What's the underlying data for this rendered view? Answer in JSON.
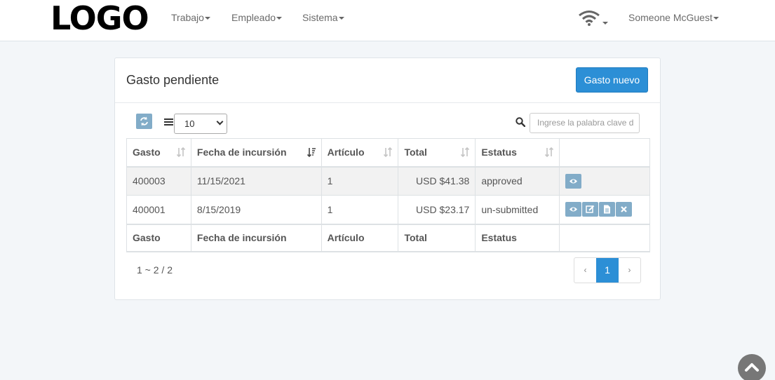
{
  "nav": {
    "logo": "LOGO",
    "menu": [
      "Trabajo",
      "Empleado",
      "Sistema"
    ],
    "user": "Someone McGuest",
    "wifi_icon": "wifi-icon"
  },
  "panel": {
    "title": "Gasto pendiente",
    "new_button": "Gasto nuevo",
    "page_size": "10",
    "search_placeholder": "Ingrese la palabra clave d"
  },
  "table": {
    "columns": [
      "Gasto",
      "Fecha de incursión",
      "Artículo",
      "Total",
      "Estatus"
    ],
    "rows": [
      {
        "id": "400003",
        "date": "11/15/2021",
        "items": "1",
        "total": "USD $41.38",
        "status": "approved",
        "actions": [
          "view-icon"
        ]
      },
      {
        "id": "400001",
        "date": "8/15/2019",
        "items": "1",
        "total": "USD $23.17",
        "status": "un-submitted",
        "actions": [
          "view-icon",
          "edit-icon",
          "file-icon",
          "close-icon"
        ]
      }
    ],
    "footer": [
      "Gasto",
      "Fecha de incursión",
      "Artículo",
      "Total",
      "Estatus"
    ]
  },
  "pagination": {
    "summary": "1 ~ 2 / 2",
    "prev": "‹",
    "current": "1",
    "next": "›"
  },
  "colors": {
    "primary": "#2c8fd6",
    "action": "#82acc8"
  }
}
